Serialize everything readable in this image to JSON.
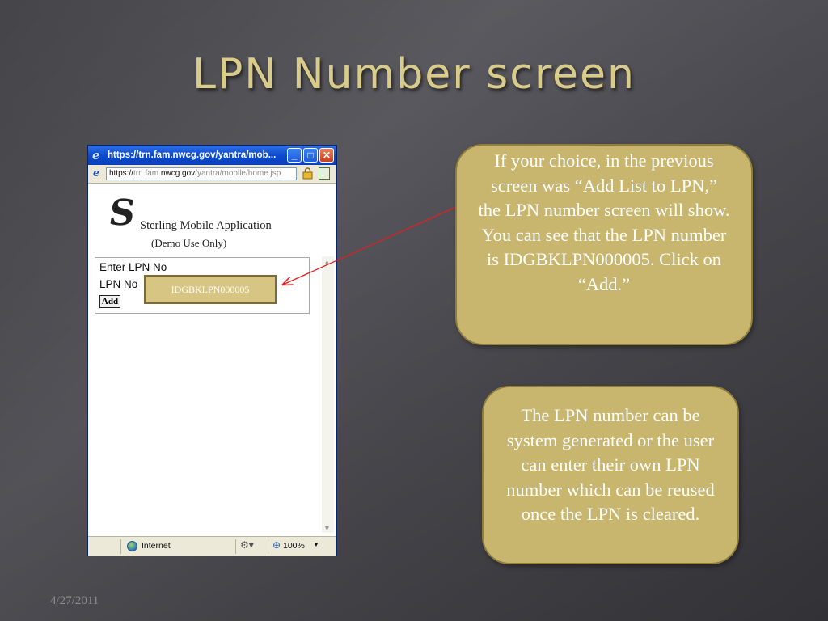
{
  "slide": {
    "title": "LPN Number screen",
    "date": "4/27/2011"
  },
  "browser": {
    "window_title": "https://trn.fam.nwcg.gov/yantra/mob...",
    "address_prefix": "https://",
    "address_host_dim1": "trn.fam.",
    "address_host_bold": "nwcg.gov",
    "address_path": "/yantra/mobile/home.jsp",
    "minimize_label": "_",
    "maximize_label": "□",
    "close_label": "✕",
    "status_zone": "Internet",
    "zoom_level": "100%"
  },
  "app": {
    "title": "Sterling Mobile Application",
    "subtitle": "(Demo Use Only)",
    "form_heading": "Enter LPN No",
    "lpn_label": "LPN No",
    "lpn_value": "IDGBKLPN000005",
    "add_button": "Add"
  },
  "callouts": {
    "first": "If your choice, in the previous screen was “Add List to LPN,” the LPN number screen will show. You can see that the LPN number is IDGBKLPN000005.  Click on “Add.”",
    "second": "The LPN number can be system generated or the user can enter their own LPN number which can be reused once the LPN is cleared."
  },
  "colors": {
    "title_gold": "#d9cc8a",
    "callout_fill": "#c8b56e",
    "arrow_red": "#e02020"
  },
  "icons": {
    "ie_logo": "ie-logo-icon",
    "lock": "lock-icon",
    "globe": "globe-icon",
    "zoom": "zoom-icon"
  }
}
